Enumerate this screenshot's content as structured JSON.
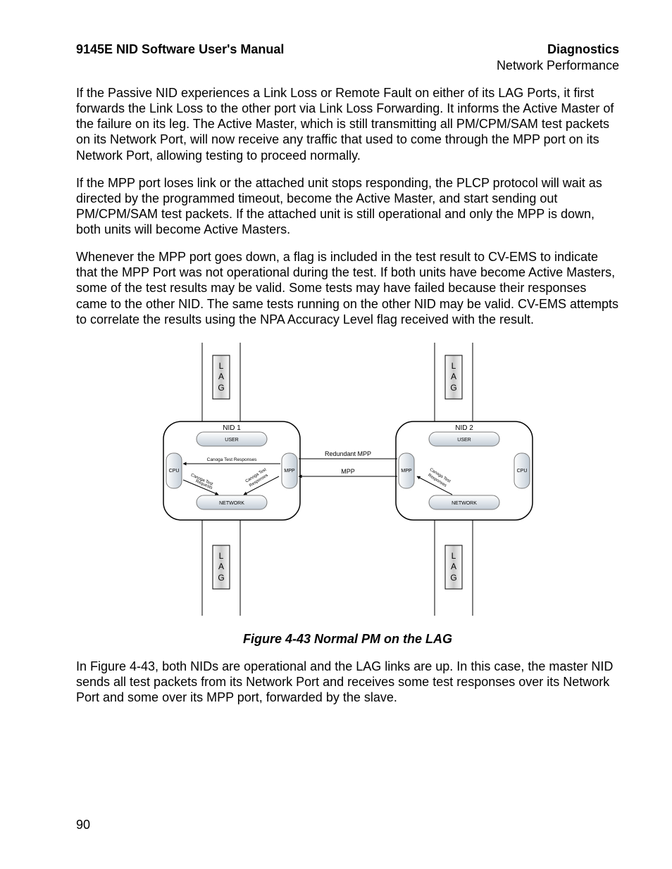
{
  "header": {
    "left": "9145E NID Software User's Manual",
    "right": "Diagnostics",
    "sub_right": "Network Performance"
  },
  "paragraphs": {
    "p1": "If the Passive NID experiences a Link Loss or Remote Fault on either of its LAG Ports, it first forwards the Link Loss to the other port via Link Loss Forwarding.  It informs the Active Master of the failure on its leg.  The Active Master, which is still transmitting all PM/CPM/SAM test packets on its Network Port,  will now receive any traffic that used to come through the MPP port on its Network Port, allowing testing to proceed normally.",
    "p2": "If the MPP port loses link or the attached unit stops responding, the PLCP protocol will wait as directed by the programmed timeout, become the Active Master, and start sending out PM/CPM/SAM test packets.  If the attached unit is still operational and only the MPP is down, both units will become Active Masters.",
    "p3": "Whenever the MPP port goes down, a flag is included in the test result to CV-EMS to indicate that the MPP Port was not operational during the test.  If both units have become Active Masters, some of the test results may be valid.  Some tests may have failed because their responses came to the other NID.  The same tests running on the other NID may be valid.  CV-EMS attempts to correlate the results using the NPA Accuracy Level flag received with the result.",
    "p4": "In Figure 4-43, both NIDs are operational and the LAG links are up.  In this case, the master NID sends all test packets from its Network Port and receives some test responses over its Network Port and some over its MPP port, forwarded by the slave."
  },
  "figure": {
    "caption": "Figure 4-43  Normal PM on the LAG",
    "labels": {
      "lag_l": "L",
      "lag_a": "A",
      "lag_g": "G",
      "nid1": "NID 1",
      "nid2": "NID 2",
      "user": "USER",
      "network": "NETWORK",
      "cpu": "CPU",
      "mpp": "MPP",
      "redundant_mpp": "Redundant MPP",
      "mpp_line": "MPP",
      "canoga_resp": "Canoga Test Responses",
      "canoga_req": "Canoga Test",
      "canoga_req2": "Requests",
      "canoga_resp2a": "Canoga Test",
      "canoga_resp2b": "Responses"
    }
  },
  "page_number": "90"
}
